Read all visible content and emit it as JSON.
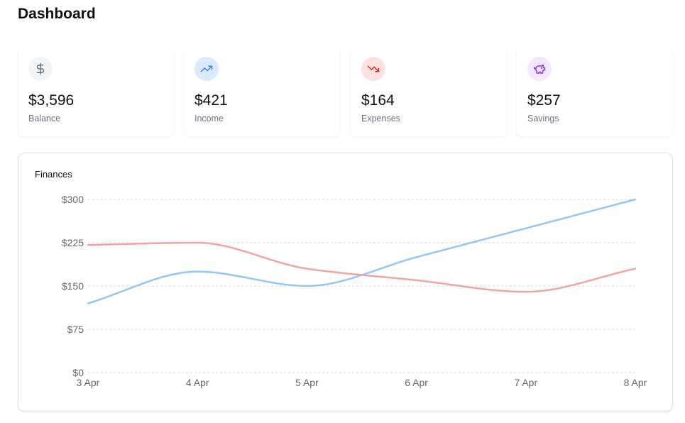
{
  "page": {
    "title": "Dashboard"
  },
  "cards": [
    {
      "value": "$3,596",
      "label": "Balance",
      "icon": "dollar-icon",
      "icon_color": "#6b7280",
      "icon_bg": "#f3f4f6"
    },
    {
      "value": "$421",
      "label": "Income",
      "icon": "trending-up-icon",
      "icon_color": "#3b82f6",
      "icon_bg": "#dbeafe"
    },
    {
      "value": "$164",
      "label": "Expenses",
      "icon": "trending-down-icon",
      "icon_color": "#dc2626",
      "icon_bg": "#fee2e2"
    },
    {
      "value": "$257",
      "label": "Savings",
      "icon": "piggy-bank-icon",
      "icon_color": "#9333ea",
      "icon_bg": "#f3e8ff"
    }
  ],
  "chart": {
    "title": "Finances"
  },
  "chart_data": {
    "type": "line",
    "categories": [
      "3 Apr",
      "4 Apr",
      "5 Apr",
      "6 Apr",
      "7 Apr",
      "8 Apr"
    ],
    "series": [
      {
        "values": [
          120,
          175,
          150,
          200,
          250,
          300
        ],
        "color": "#93c5f5"
      },
      {
        "values": [
          221,
          225,
          180,
          160,
          140,
          180
        ],
        "color": "#f4a3a3"
      }
    ],
    "y_ticks": [
      "$0",
      "$75",
      "$150",
      "$225",
      "$300"
    ],
    "y_tick_values": [
      0,
      75,
      150,
      225,
      300
    ],
    "ylim": [
      0,
      300
    ],
    "grid": true,
    "smooth": true
  }
}
